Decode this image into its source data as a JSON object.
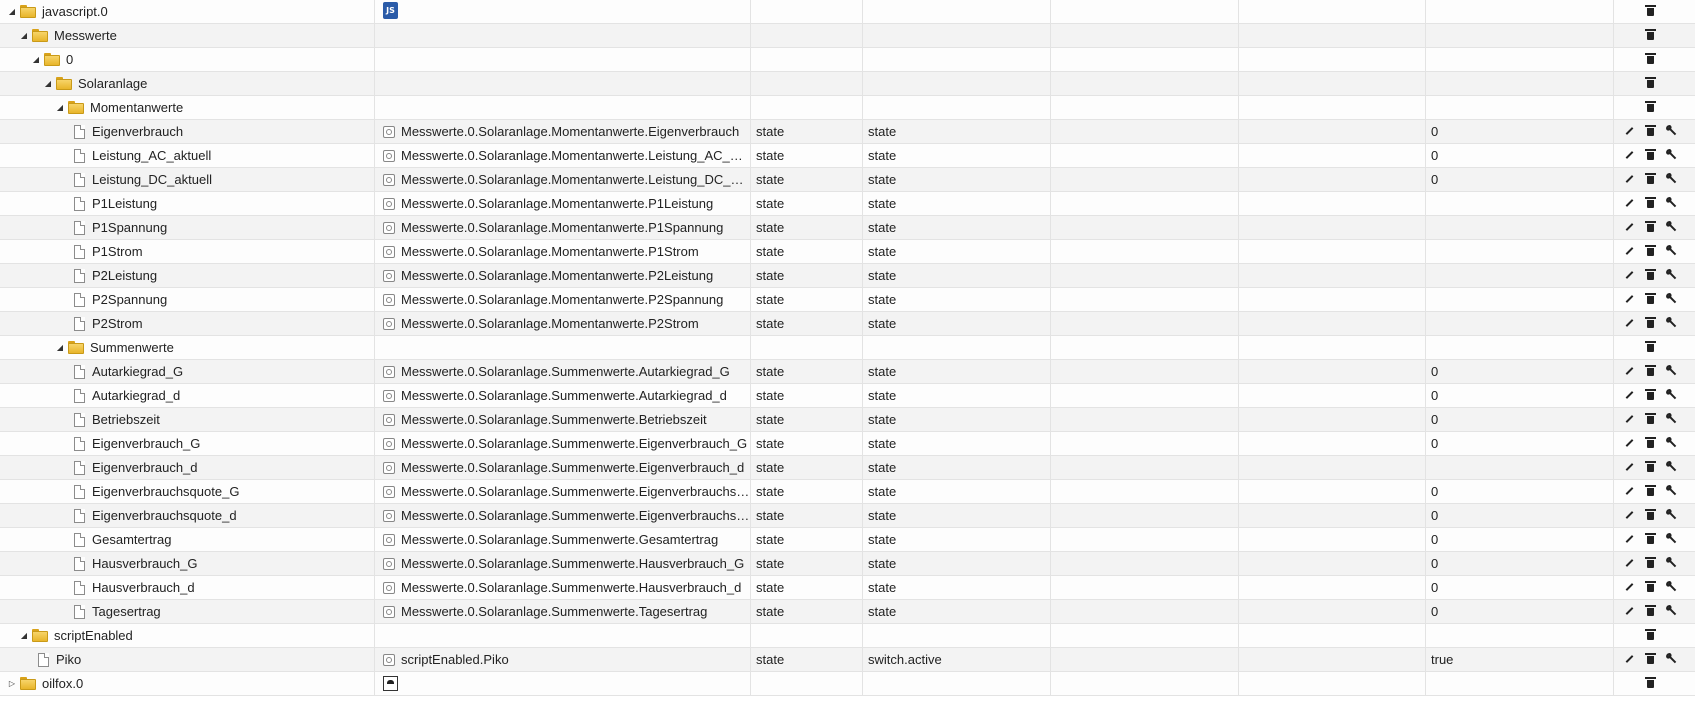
{
  "rows": [
    {
      "kind": "folder",
      "level": 0,
      "expanded": true,
      "name": "javascript.0",
      "id": "",
      "id_icon": "js",
      "type": "",
      "role": "",
      "value": "",
      "actions": [
        "delete"
      ]
    },
    {
      "kind": "folder",
      "level": 1,
      "expanded": true,
      "name": "Messwerte",
      "id": "",
      "type": "",
      "role": "",
      "value": "",
      "actions": [
        "delete"
      ]
    },
    {
      "kind": "folder",
      "level": 2,
      "expanded": true,
      "name": "0",
      "id": "",
      "type": "",
      "role": "",
      "value": "",
      "actions": [
        "delete"
      ]
    },
    {
      "kind": "folder",
      "level": 3,
      "expanded": true,
      "name": "Solaranlage",
      "id": "",
      "type": "",
      "role": "",
      "value": "",
      "actions": [
        "delete"
      ]
    },
    {
      "kind": "folder",
      "level": 4,
      "expanded": true,
      "name": "Momentanwerte",
      "id": "",
      "type": "",
      "role": "",
      "value": "",
      "actions": [
        "delete"
      ]
    },
    {
      "kind": "state",
      "level": 5,
      "name": "Eigenverbrauch",
      "id": "Messwerte.0.Solaranlage.Momentanwerte.Eigenverbrauch",
      "type": "state",
      "role": "state",
      "value": "0",
      "actions": [
        "edit",
        "delete",
        "wrench"
      ]
    },
    {
      "kind": "state",
      "level": 5,
      "name": "Leistung_AC_aktuell",
      "id": "Messwerte.0.Solaranlage.Momentanwerte.Leistung_AC_akt...",
      "type": "state",
      "role": "state",
      "value": "0",
      "actions": [
        "edit",
        "delete",
        "wrench"
      ]
    },
    {
      "kind": "state",
      "level": 5,
      "name": "Leistung_DC_aktuell",
      "id": "Messwerte.0.Solaranlage.Momentanwerte.Leistung_DC_ak...",
      "type": "state",
      "role": "state",
      "value": "0",
      "actions": [
        "edit",
        "delete",
        "wrench"
      ]
    },
    {
      "kind": "state",
      "level": 5,
      "name": "P1Leistung",
      "id": "Messwerte.0.Solaranlage.Momentanwerte.P1Leistung",
      "type": "state",
      "role": "state",
      "value": "",
      "actions": [
        "edit",
        "delete",
        "wrench"
      ]
    },
    {
      "kind": "state",
      "level": 5,
      "name": "P1Spannung",
      "id": "Messwerte.0.Solaranlage.Momentanwerte.P1Spannung",
      "type": "state",
      "role": "state",
      "value": "",
      "actions": [
        "edit",
        "delete",
        "wrench"
      ]
    },
    {
      "kind": "state",
      "level": 5,
      "name": "P1Strom",
      "id": "Messwerte.0.Solaranlage.Momentanwerte.P1Strom",
      "type": "state",
      "role": "state",
      "value": "",
      "actions": [
        "edit",
        "delete",
        "wrench"
      ]
    },
    {
      "kind": "state",
      "level": 5,
      "name": "P2Leistung",
      "id": "Messwerte.0.Solaranlage.Momentanwerte.P2Leistung",
      "type": "state",
      "role": "state",
      "value": "",
      "actions": [
        "edit",
        "delete",
        "wrench"
      ]
    },
    {
      "kind": "state",
      "level": 5,
      "name": "P2Spannung",
      "id": "Messwerte.0.Solaranlage.Momentanwerte.P2Spannung",
      "type": "state",
      "role": "state",
      "value": "",
      "actions": [
        "edit",
        "delete",
        "wrench"
      ]
    },
    {
      "kind": "state",
      "level": 5,
      "name": "P2Strom",
      "id": "Messwerte.0.Solaranlage.Momentanwerte.P2Strom",
      "type": "state",
      "role": "state",
      "value": "",
      "actions": [
        "edit",
        "delete",
        "wrench"
      ]
    },
    {
      "kind": "folder",
      "level": 4,
      "expanded": true,
      "name": "Summenwerte",
      "id": "",
      "type": "",
      "role": "",
      "value": "",
      "actions": [
        "delete"
      ]
    },
    {
      "kind": "state",
      "level": 5,
      "name": "Autarkiegrad_G",
      "id": "Messwerte.0.Solaranlage.Summenwerte.Autarkiegrad_G",
      "type": "state",
      "role": "state",
      "value": "0",
      "actions": [
        "edit",
        "delete",
        "wrench"
      ]
    },
    {
      "kind": "state",
      "level": 5,
      "name": "Autarkiegrad_d",
      "id": "Messwerte.0.Solaranlage.Summenwerte.Autarkiegrad_d",
      "type": "state",
      "role": "state",
      "value": "0",
      "actions": [
        "edit",
        "delete",
        "wrench"
      ]
    },
    {
      "kind": "state",
      "level": 5,
      "name": "Betriebszeit",
      "id": "Messwerte.0.Solaranlage.Summenwerte.Betriebszeit",
      "type": "state",
      "role": "state",
      "value": "0",
      "actions": [
        "edit",
        "delete",
        "wrench"
      ]
    },
    {
      "kind": "state",
      "level": 5,
      "name": "Eigenverbrauch_G",
      "id": "Messwerte.0.Solaranlage.Summenwerte.Eigenverbrauch_G",
      "type": "state",
      "role": "state",
      "value": "0",
      "actions": [
        "edit",
        "delete",
        "wrench"
      ]
    },
    {
      "kind": "state",
      "level": 5,
      "name": "Eigenverbrauch_d",
      "id": "Messwerte.0.Solaranlage.Summenwerte.Eigenverbrauch_d",
      "type": "state",
      "role": "state",
      "value": "",
      "actions": [
        "edit",
        "delete",
        "wrench"
      ]
    },
    {
      "kind": "state",
      "level": 5,
      "name": "Eigenverbrauchsquote_G",
      "id": "Messwerte.0.Solaranlage.Summenwerte.Eigenverbrauchsq...",
      "type": "state",
      "role": "state",
      "value": "0",
      "actions": [
        "edit",
        "delete",
        "wrench"
      ]
    },
    {
      "kind": "state",
      "level": 5,
      "name": "Eigenverbrauchsquote_d",
      "id": "Messwerte.0.Solaranlage.Summenwerte.Eigenverbrauchsq...",
      "type": "state",
      "role": "state",
      "value": "0",
      "actions": [
        "edit",
        "delete",
        "wrench"
      ]
    },
    {
      "kind": "state",
      "level": 5,
      "name": "Gesamtertrag",
      "id": "Messwerte.0.Solaranlage.Summenwerte.Gesamtertrag",
      "type": "state",
      "role": "state",
      "value": "0",
      "actions": [
        "edit",
        "delete",
        "wrench"
      ]
    },
    {
      "kind": "state",
      "level": 5,
      "name": "Hausverbrauch_G",
      "id": "Messwerte.0.Solaranlage.Summenwerte.Hausverbrauch_G",
      "type": "state",
      "role": "state",
      "value": "0",
      "actions": [
        "edit",
        "delete",
        "wrench"
      ]
    },
    {
      "kind": "state",
      "level": 5,
      "name": "Hausverbrauch_d",
      "id": "Messwerte.0.Solaranlage.Summenwerte.Hausverbrauch_d",
      "type": "state",
      "role": "state",
      "value": "0",
      "actions": [
        "edit",
        "delete",
        "wrench"
      ]
    },
    {
      "kind": "state",
      "level": 5,
      "name": "Tagesertrag",
      "id": "Messwerte.0.Solaranlage.Summenwerte.Tagesertrag",
      "type": "state",
      "role": "state",
      "value": "0",
      "actions": [
        "edit",
        "delete",
        "wrench"
      ]
    },
    {
      "kind": "folder",
      "level": 1,
      "expanded": true,
      "name": "scriptEnabled",
      "id": "",
      "type": "",
      "role": "",
      "value": "",
      "actions": [
        "delete"
      ]
    },
    {
      "kind": "state",
      "level": 2,
      "name": "Piko",
      "id": "scriptEnabled.Piko",
      "type": "state",
      "role": "switch.active",
      "value": "true",
      "actions": [
        "edit",
        "delete",
        "wrench"
      ]
    },
    {
      "kind": "folder",
      "level": 0,
      "expanded": false,
      "name": "oilfox.0",
      "id": "",
      "id_icon": "oilfox",
      "type": "",
      "role": "",
      "value": "",
      "actions": [
        "delete"
      ]
    }
  ],
  "colors": {
    "folder": "#f0c24a",
    "js_badge": "#2a5ba8",
    "row_alt": "#f3f3f3",
    "grid": "#e3e3e3"
  }
}
